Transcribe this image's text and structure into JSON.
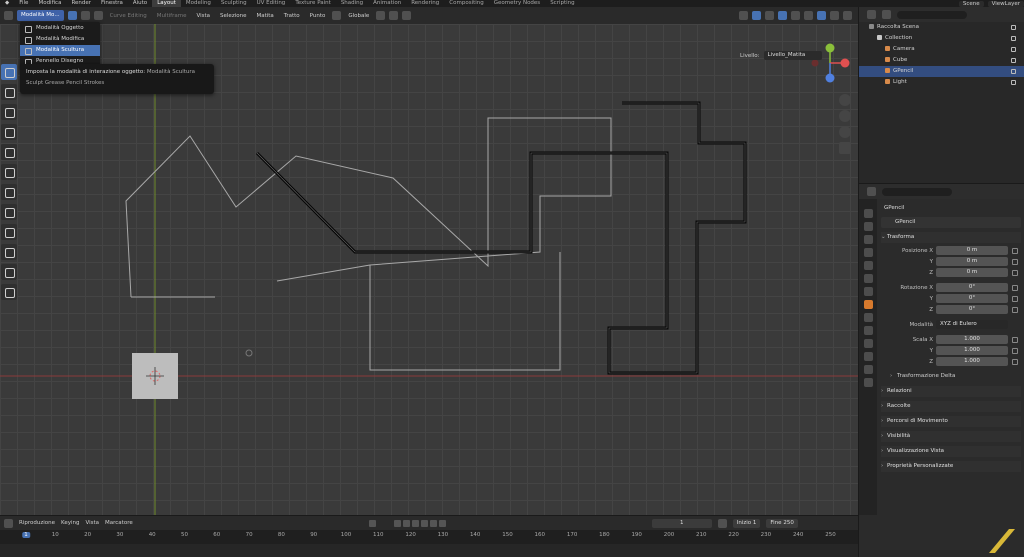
{
  "topbar": {
    "menus": [
      "File",
      "Modifica",
      "Render",
      "Finestra",
      "Aiuto"
    ],
    "workspaces": [
      "Layout",
      "Modeling",
      "Sculpting",
      "UV Editing",
      "Texture Paint",
      "Shading",
      "Animation",
      "Rendering",
      "Compositing",
      "Geometry Nodes",
      "Scripting"
    ],
    "active_workspace": "Layout",
    "scene": "Scene",
    "view_layer": "ViewLayer"
  },
  "viewport_header": {
    "mode_button": "Modalità Mo...",
    "curve_editing": "Curve Editing",
    "multiframe": "Multiframe",
    "menus": [
      "Vista",
      "Selezione",
      "Matita",
      "Tratto",
      "Punto"
    ],
    "transform_orientation": "Globale"
  },
  "mode_menu": {
    "items": [
      "Modalità Oggetto",
      "Modalità Modifica",
      "Modalità Scultura",
      "Pennello Disegno"
    ],
    "selected_index": 2
  },
  "tooltip": {
    "text": "Imposta la modalità di interazione oggetto:",
    "mode": "Modalità Scultura",
    "python": "Sculpt Grease Pencil Strokes"
  },
  "viewport": {
    "layer_label": "Livello:",
    "layer_name": "Livello_Matita",
    "gizmo": {
      "y": "Y",
      "x": "X",
      "z": "Z"
    }
  },
  "outliner": {
    "rows": [
      {
        "label": "Raccolta Scena",
        "depth": 0,
        "color": "#8a8a8a"
      },
      {
        "label": "Collection",
        "depth": 1,
        "color": "#c8c8c8"
      },
      {
        "label": "Camera",
        "depth": 2,
        "color": "#d88a4a"
      },
      {
        "label": "Cube",
        "depth": 2,
        "color": "#d88a4a"
      },
      {
        "label": "GPencil",
        "depth": 2,
        "color": "#d88a4a",
        "selected": true
      },
      {
        "label": "Light",
        "depth": 2,
        "color": "#d88a4a"
      }
    ]
  },
  "properties": {
    "object_title": "GPencil",
    "object_name": "GPencil",
    "transform_header": "Trasforma",
    "location": {
      "label": "Posizione X",
      "y": "Y",
      "z": "Z",
      "x_val": "0 m",
      "y_val": "0 m",
      "z_val": "0 m"
    },
    "rotation": {
      "label": "Rotazione X",
      "y": "Y",
      "z": "Z",
      "x_val": "0°",
      "y_val": "0°",
      "z_val": "0°"
    },
    "mode": {
      "label": "Modalità",
      "value": "XYZ di Eulero"
    },
    "scale": {
      "label": "Scala X",
      "y": "Y",
      "z": "Z",
      "x_val": "1.000",
      "y_val": "1.000",
      "z_val": "1.000"
    },
    "delta_transform": "Trasformazione Delta",
    "panels": [
      "Relazioni",
      "Raccolte",
      "Percorsi di Movimento",
      "Visibilità",
      "Visualizzazione Vista",
      "Proprietà Personalizzate"
    ]
  },
  "timeline": {
    "menus": [
      "Riproduzione",
      "Keying",
      "Vista",
      "Marcatore"
    ],
    "current_frame": "1",
    "start_label": "Inizio",
    "start_value": "1",
    "end_label": "Fine",
    "end_value": "250",
    "ticks": [
      "1",
      "10",
      "20",
      "30",
      "40",
      "50",
      "60",
      "70",
      "80",
      "90",
      "100",
      "110",
      "120",
      "130",
      "140",
      "150",
      "160",
      "170",
      "180",
      "190",
      "200",
      "210",
      "220",
      "230",
      "240",
      "250"
    ]
  },
  "colors": {
    "accent": "#4772b3",
    "stroke_black": "#050505",
    "stroke_gray": "#a8a8a8",
    "x_axis": "#a03c3c",
    "y_axis": "#7a9a2a"
  }
}
